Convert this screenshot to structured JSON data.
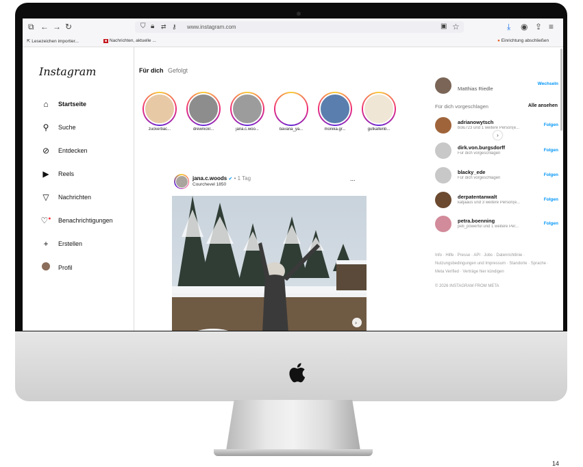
{
  "browser": {
    "url": "www.instagram.com",
    "bookmarks": {
      "import": "Lesezeichen importier...",
      "news": "Nachrichten, aktuelle ...",
      "setup": "Einrichtung abschließen"
    }
  },
  "sidebar": {
    "logo": "Instagram",
    "items": [
      {
        "label": "Startseite",
        "icon": "home-icon"
      },
      {
        "label": "Suche",
        "icon": "search-icon"
      },
      {
        "label": "Entdecken",
        "icon": "compass-icon"
      },
      {
        "label": "Reels",
        "icon": "reels-icon"
      },
      {
        "label": "Nachrichten",
        "icon": "send-icon"
      },
      {
        "label": "Benachrichtigungen",
        "icon": "heart-icon"
      },
      {
        "label": "Erstellen",
        "icon": "plus-icon"
      },
      {
        "label": "Profil",
        "icon": "profile-avatar"
      }
    ]
  },
  "feed": {
    "tabs": [
      "Für dich",
      "Gefolgt"
    ],
    "stories": [
      {
        "name": "zuckerbac...",
        "color": "#e8c9a6"
      },
      {
        "name": "drewnickr...",
        "color": "#8d8d8d"
      },
      {
        "name": "jana.c.woo...",
        "color": "#9c9c9c"
      },
      {
        "name": "bavaria_ya...",
        "color": "#ffffff"
      },
      {
        "name": "monika.gr...",
        "color": "#5a7fae"
      },
      {
        "name": "gutkaltenb...",
        "color": "#efe6d6"
      }
    ],
    "post": {
      "user": "jana.c.woods",
      "time": "• 1 Tag",
      "location": "Courchevel 1850",
      "more": "..."
    }
  },
  "right": {
    "current_user": {
      "name": "Matthias Riedle",
      "switch": "Wechseln"
    },
    "suggest_title": "Für dich vorgeschlagen",
    "see_all": "Alle ansehen",
    "suggestions": [
      {
        "name": "adrianowytsch",
        "sub": "bolu723 und 1 weitere Person(e...",
        "follow": "Folgen",
        "color": "#a0643a"
      },
      {
        "name": "dirk.von.burgsdorff",
        "sub": "Für dich vorgeschlagen",
        "follow": "Folgen",
        "color": "#c8c8c8"
      },
      {
        "name": "blacky_ede",
        "sub": "Für dich vorgeschlagen",
        "follow": "Folgen",
        "color": "#c8c8c8"
      },
      {
        "name": "derpatentanwalt",
        "sub": "katjaaus und 3 weitere Person(e...",
        "follow": "Folgen",
        "color": "#6b4a30"
      },
      {
        "name": "petra.boenning",
        "sub": "peti_powerful und 1 weitere Per...",
        "follow": "Folgen",
        "color": "#d28b9a"
      }
    ],
    "footer": "Info · Hilfe · Presse · API · Jobs · Datenrichtlinie · Nutzungsbedingungen und Impressum · Standorte · Sprache · Meta Verified · Verträge hier kündigen",
    "copyright": "© 2026 INSTAGRAM FROM META"
  },
  "page_number": "14"
}
